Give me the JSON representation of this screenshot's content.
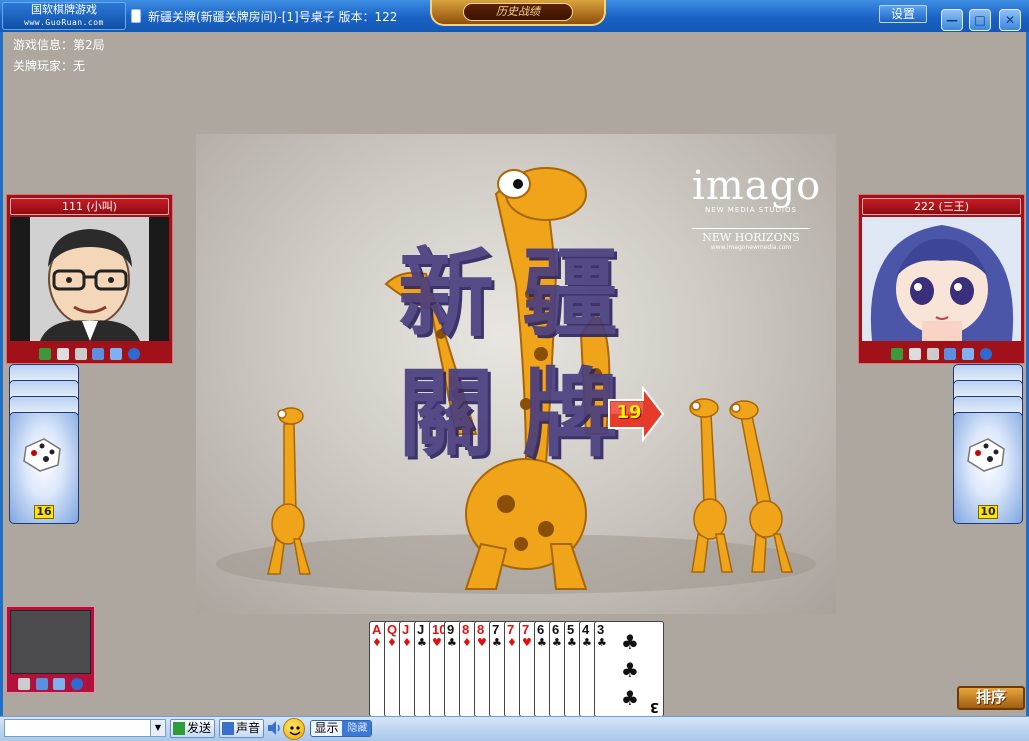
{
  "app": {
    "logo_line1": "国软棋牌游戏",
    "logo_line2": "www.GuoRuan.com",
    "title": "新疆关牌(新疆关牌房间)-[1]号桌子 版本：122",
    "banner": "历史战绩",
    "settings_label": "设置",
    "minimize_label": "—",
    "maximize_label": "□",
    "close_label": "✕"
  },
  "game_info": {
    "round": "游戏信息：第2局",
    "closer": "关牌玩家：无"
  },
  "board": {
    "title_line1": "新疆",
    "title_line2": "關牌",
    "watermark_logo": "imago",
    "watermark_sub": "NEW MEDIA STUDIOS",
    "watermark_tag": "NEW HORIZONS",
    "watermark_url": "www.imagonewmedia.com"
  },
  "timer": {
    "seconds": "19"
  },
  "players": {
    "left": {
      "name": "111 (小叫)",
      "cards_left": "16"
    },
    "right": {
      "name": "222 (三王)",
      "cards_left": "10"
    }
  },
  "hand": [
    {
      "rank": "A",
      "suit": "♦",
      "color": "red"
    },
    {
      "rank": "Q",
      "suit": "♦",
      "color": "red"
    },
    {
      "rank": "J",
      "suit": "♦",
      "color": "red"
    },
    {
      "rank": "J",
      "suit": "♣",
      "color": "black"
    },
    {
      "rank": "10",
      "suit": "♥",
      "color": "red"
    },
    {
      "rank": "9",
      "suit": "♣",
      "color": "black"
    },
    {
      "rank": "8",
      "suit": "♦",
      "color": "red"
    },
    {
      "rank": "8",
      "suit": "♥",
      "color": "red"
    },
    {
      "rank": "7",
      "suit": "♣",
      "color": "black"
    },
    {
      "rank": "7",
      "suit": "♦",
      "color": "red"
    },
    {
      "rank": "7",
      "suit": "♥",
      "color": "red"
    },
    {
      "rank": "6",
      "suit": "♣",
      "color": "black"
    },
    {
      "rank": "6",
      "suit": "♣",
      "color": "black"
    },
    {
      "rank": "5",
      "suit": "♣",
      "color": "black"
    },
    {
      "rank": "4",
      "suit": "♣",
      "color": "black"
    },
    {
      "rank": "3",
      "suit": "♣",
      "color": "black"
    }
  ],
  "controls": {
    "sort_label": "排序",
    "send_label": "发送",
    "sound_label": "声音",
    "show_label": "显示",
    "hide_label": "隐藏"
  },
  "colors": {
    "title_bar": "#1a62c4",
    "table_bg": "#ada7a0",
    "panel_red": "#a0111a",
    "count_badge": "#ffe500"
  }
}
